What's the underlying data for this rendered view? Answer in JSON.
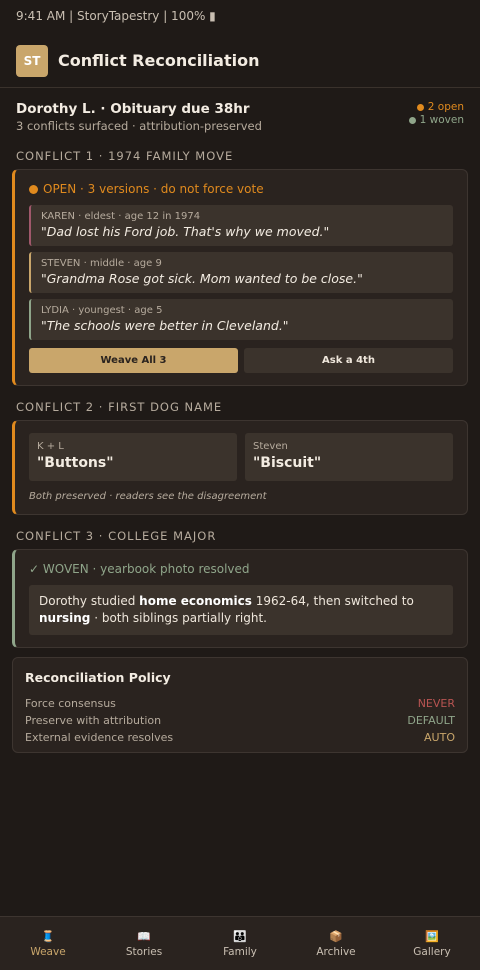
{
  "status_bar": {
    "text": "9:41 AM | StoryTapestry | 100% ▮"
  },
  "header": {
    "logo": "ST",
    "title": "Conflict Reconciliation"
  },
  "summary": {
    "title": "Dorothy L. · Obituary due 38hr",
    "subtitle": "3 conflicts surfaced · attribution-preserved",
    "open_count": "2 open",
    "woven_count": "1 woven"
  },
  "conflict1": {
    "label": "CONFLICT 1 · 1974 FAMILY MOVE",
    "status": "OPEN · 3 versions · do not force vote",
    "versions": [
      {
        "meta": "KAREN · eldest · age 12 in 1974",
        "quote": "\"Dad lost his Ford job. That's why we moved.\""
      },
      {
        "meta": "STEVEN · middle · age 9",
        "quote": "\"Grandma Rose got sick. Mom wanted to be close.\""
      },
      {
        "meta": "LYDIA · youngest · age 5",
        "quote": "\"The schools were better in Cleveland.\""
      }
    ],
    "primary_button": "Weave All 3",
    "secondary_button": "Ask a 4th"
  },
  "conflict2": {
    "label": "CONFLICT 2 · FIRST DOG NAME",
    "options": [
      {
        "who": "K + L",
        "name": "\"Buttons\""
      },
      {
        "who": "Steven",
        "name": "\"Biscuit\""
      }
    ],
    "note": "Both preserved · readers see the disagreement"
  },
  "conflict3": {
    "label": "CONFLICT 3 · COLLEGE MAJOR",
    "status": "✓ WOVEN · yearbook photo resolved",
    "text_1": "Dorothy studied ",
    "bold_1": "home economics",
    "text_2": " 1962-64, then switched to ",
    "bold_2": "nursing",
    "text_3": " · both siblings partially right."
  },
  "policy": {
    "title": "Reconciliation Policy",
    "rows": [
      {
        "label": "Force consensus",
        "value": "NEVER"
      },
      {
        "label": "Preserve with attribution",
        "value": "DEFAULT"
      },
      {
        "label": "External evidence resolves",
        "value": "AUTO"
      }
    ]
  },
  "tabs": [
    {
      "icon": "🧵",
      "label": "Weave"
    },
    {
      "icon": "📖",
      "label": "Stories"
    },
    {
      "icon": "👪",
      "label": "Family"
    },
    {
      "icon": "📦",
      "label": "Archive"
    },
    {
      "icon": "🖼️",
      "label": "Gallery"
    }
  ],
  "colors": {
    "accent": "#c9a66b",
    "open": "#e08a1e",
    "woven": "#8fa58a",
    "never": "#b85452"
  }
}
